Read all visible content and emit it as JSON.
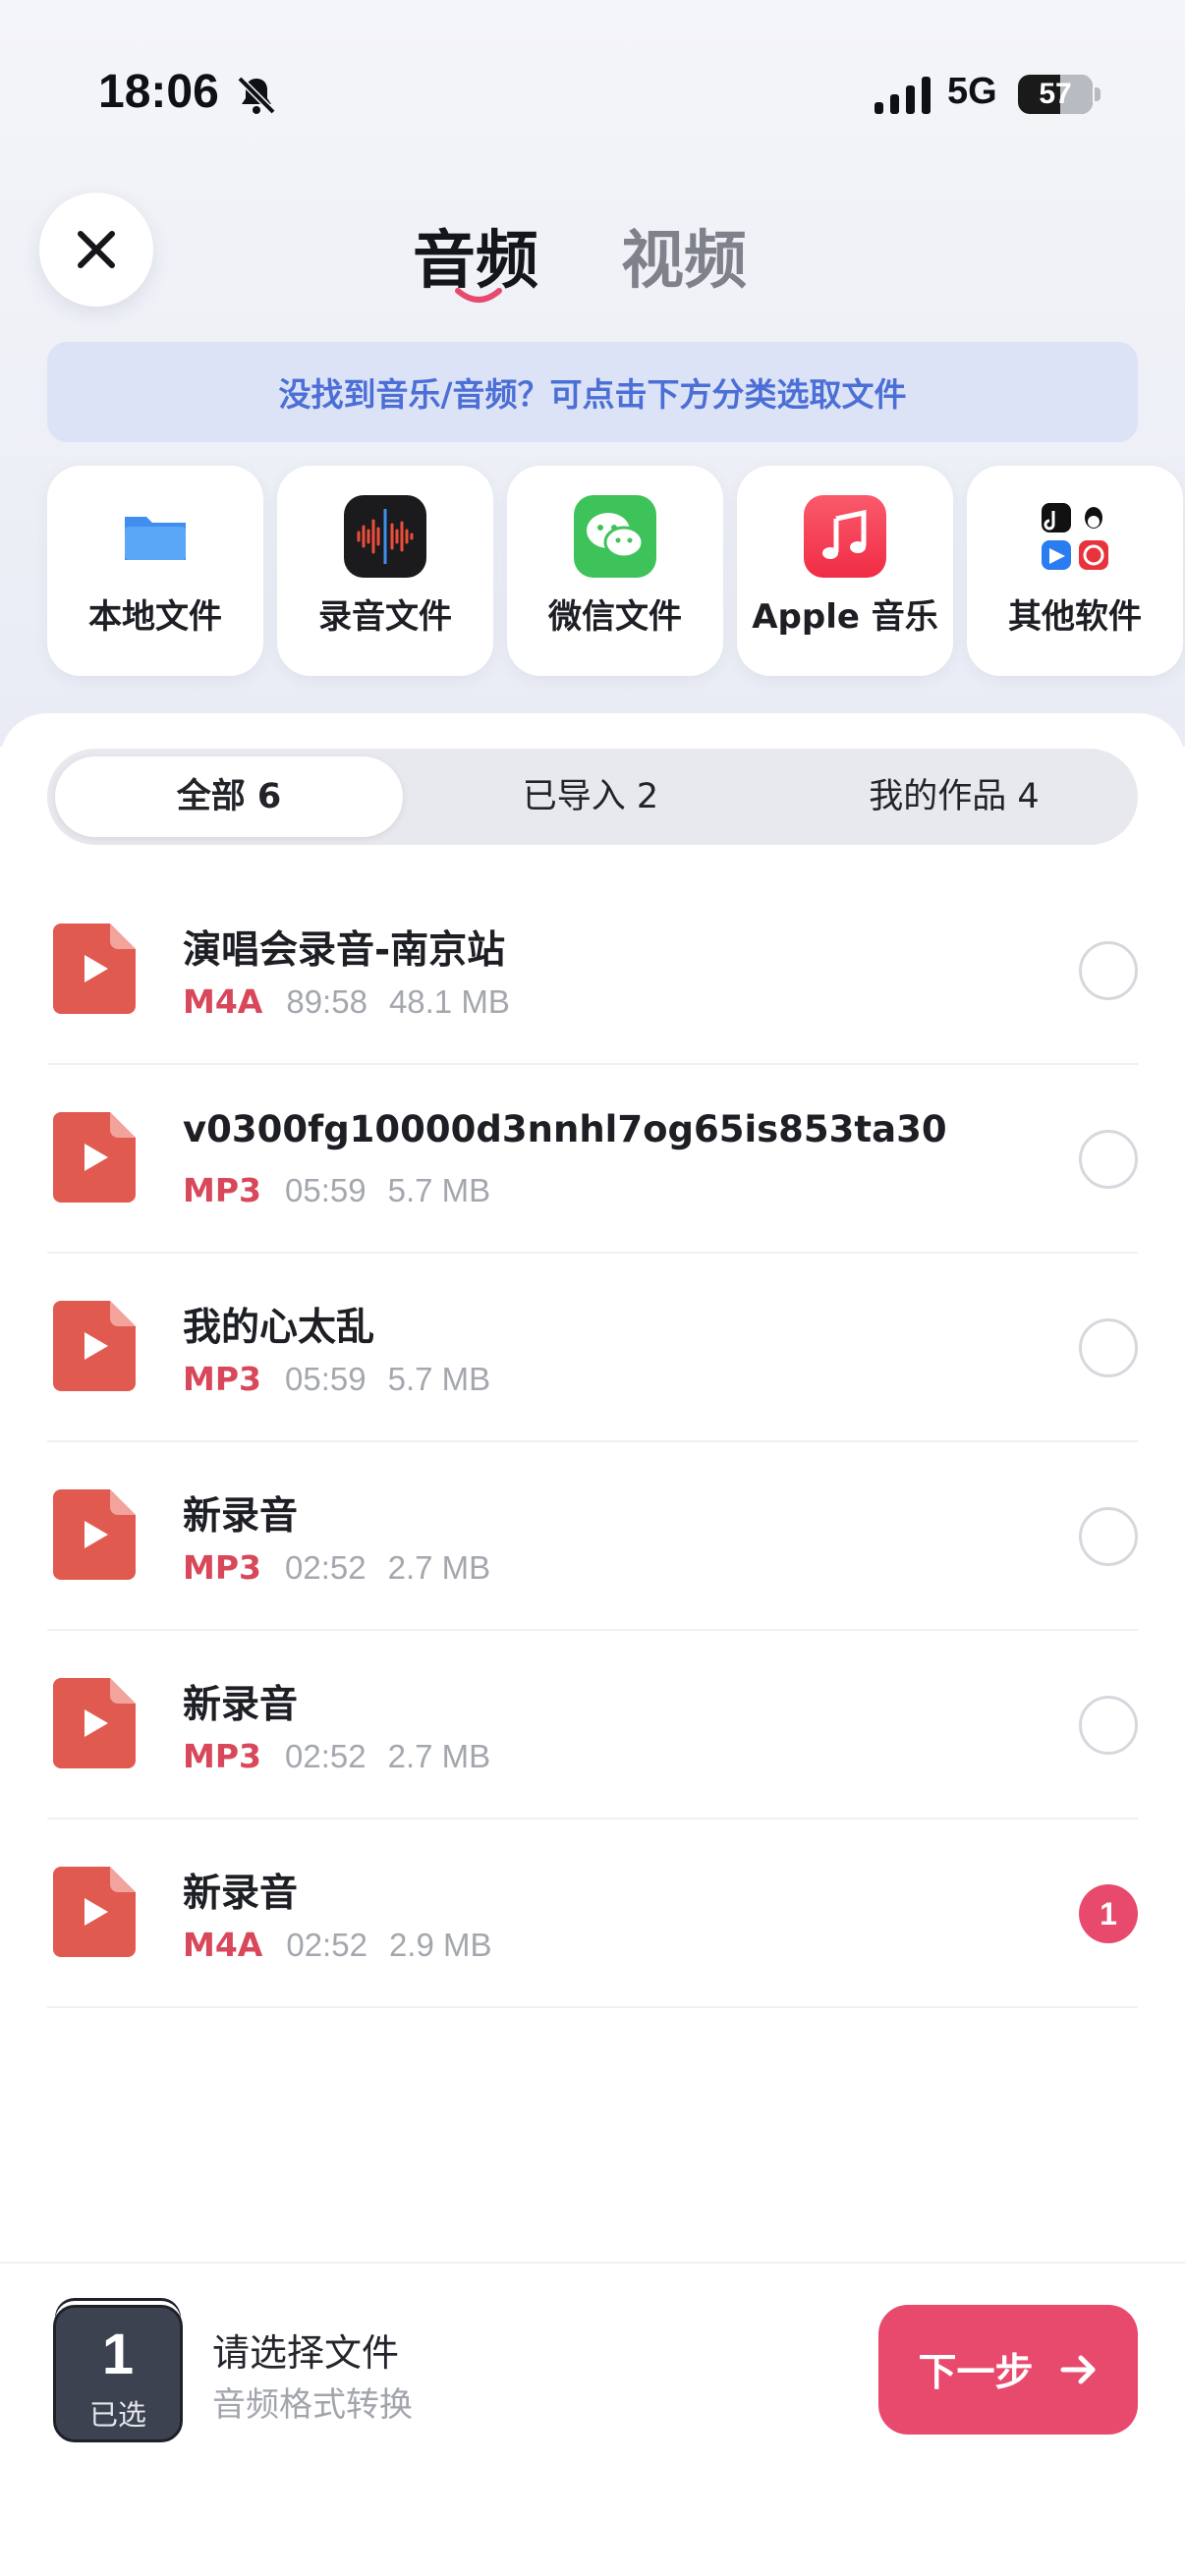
{
  "status_bar": {
    "time": "18:06",
    "network": "5G",
    "battery": "57",
    "battery_level": 0.57
  },
  "header": {
    "tab_audio": "音频",
    "tab_video": "视频",
    "active_tab": "音频"
  },
  "hint": "没找到音乐/音频？可点击下方分类选取文件",
  "sources": [
    {
      "label": "本地文件",
      "icon": "files-folder-icon"
    },
    {
      "label": "录音文件",
      "icon": "voice-memos-icon"
    },
    {
      "label": "微信文件",
      "icon": "wechat-icon"
    },
    {
      "label": "Apple 音乐",
      "icon": "apple-music-icon"
    },
    {
      "label": "其他软件",
      "icon": "other-apps-icon"
    }
  ],
  "segments": [
    {
      "label": "全部 6",
      "active": true
    },
    {
      "label": "已导入 2",
      "active": false
    },
    {
      "label": "我的作品 4",
      "active": false
    }
  ],
  "files": [
    {
      "name": "演唱会录音-南京站",
      "format": "M4A",
      "duration": "89:58",
      "size": "48.1 MB",
      "selected": ""
    },
    {
      "name": "v0300fg10000d3nnhl7og65is853ta30",
      "format": "MP3",
      "duration": "05:59",
      "size": "5.7 MB",
      "selected": ""
    },
    {
      "name": "我的心太乱",
      "format": "MP3",
      "duration": "05:59",
      "size": "5.7 MB",
      "selected": ""
    },
    {
      "name": "新录音",
      "format": "MP3",
      "duration": "02:52",
      "size": "2.7 MB",
      "selected": ""
    },
    {
      "name": "新录音",
      "format": "MP3",
      "duration": "02:52",
      "size": "2.7 MB",
      "selected": ""
    },
    {
      "name": "新录音",
      "format": "M4A",
      "duration": "02:52",
      "size": "2.9 MB",
      "selected": "1"
    }
  ],
  "bottom": {
    "count": "1",
    "count_label": "已选",
    "title": "请选择文件",
    "subtitle": "音频格式转换",
    "next_label": "下一步"
  },
  "colors": {
    "accent": "#e84a6e",
    "format_red": "#d8475a",
    "hint_blue": "#4b6fd6"
  }
}
